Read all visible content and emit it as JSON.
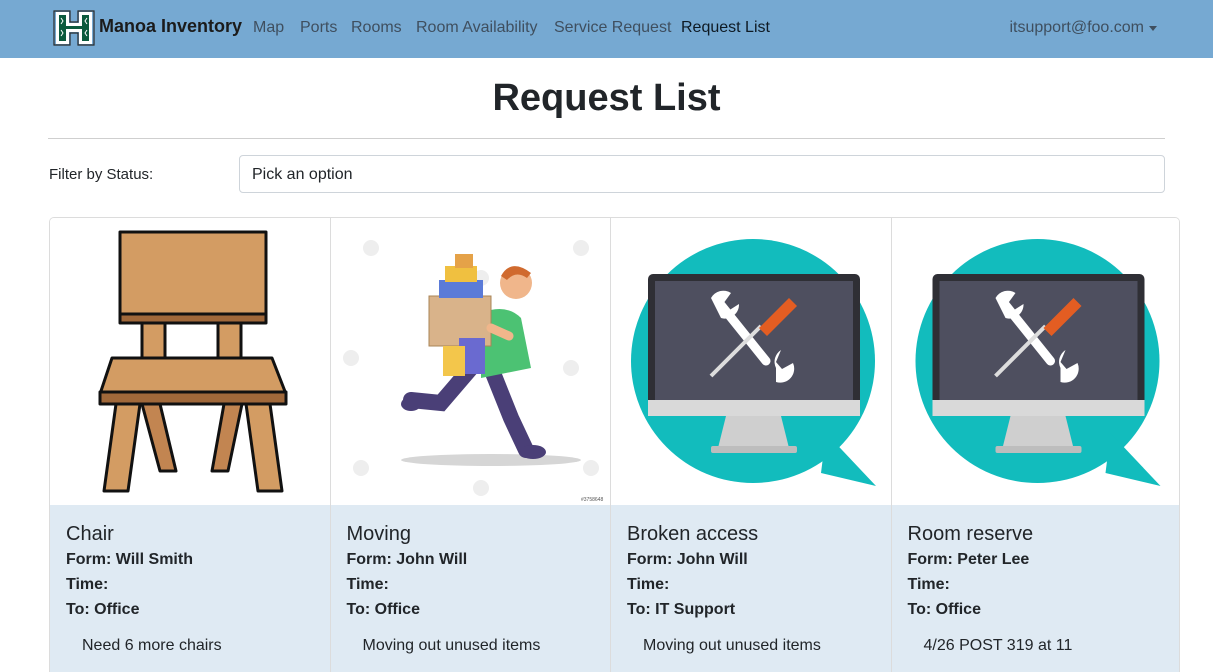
{
  "navbar": {
    "brand": "Manoa Inventory",
    "links": [
      "Map",
      "Ports",
      "Rooms",
      "Room Availability",
      "Service Request",
      "Request List"
    ],
    "user": "itsupport@foo.com"
  },
  "page": {
    "title": "Request List",
    "filter_label": "Filter by Status:",
    "filter_placeholder": "Pick an option"
  },
  "cards": [
    {
      "title": "Chair",
      "form": "Form: Will Smith",
      "time": "Time:",
      "to": "To: Office",
      "note": "Need 6 more chairs",
      "image": "chair"
    },
    {
      "title": "Moving",
      "form": "Form: John Will",
      "time": "Time:",
      "to": "To: Office",
      "note": "Moving out unused items",
      "image": "moving-person",
      "watermark": "#3758648"
    },
    {
      "title": "Broken access",
      "form": "Form: John Will",
      "time": "Time:",
      "to": "To: IT Support",
      "note": "Moving out unused items",
      "image": "computer-repair"
    },
    {
      "title": "Room reserve",
      "form": "Form: Peter Lee",
      "time": "Time:",
      "to": "To: Office",
      "note": "4/26 POST 319 at 11",
      "image": "computer-repair"
    }
  ],
  "colors": {
    "navbar": "#76a9d2",
    "card_body": "#dfeaf3",
    "teal": "#12bcbd",
    "monitor": "#4e4f5f",
    "wrench": "#e35d22"
  }
}
